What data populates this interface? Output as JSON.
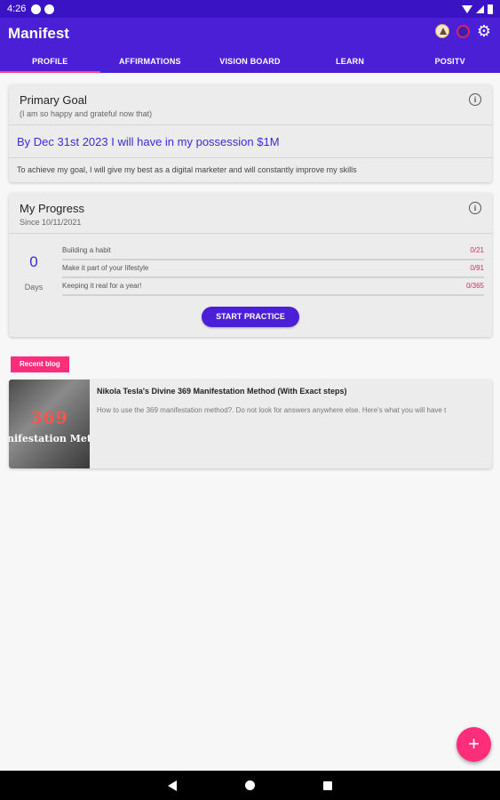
{
  "status_bar": {
    "time": "4:26"
  },
  "app": {
    "title": "Manifest"
  },
  "tabs": [
    {
      "label": "PROFILE",
      "active": true
    },
    {
      "label": "AFFIRMATIONS",
      "active": false
    },
    {
      "label": "VISION BOARD",
      "active": false
    },
    {
      "label": "LEARN",
      "active": false
    },
    {
      "label": "POSITV",
      "active": false
    }
  ],
  "primary_goal": {
    "heading": "Primary Goal",
    "subheading": "(I am so happy and grateful now that)",
    "statement": "By Dec 31st 2023 I will have in my possession $1M",
    "plan": "To achieve my goal, I will give my best as a digital marketer and will constantly improve my skills"
  },
  "progress": {
    "heading": "My Progress",
    "since": "Since 10/11/2021",
    "days_value": "0",
    "days_label": "Days",
    "goals": [
      {
        "label": "Building a habit",
        "count": "0/21"
      },
      {
        "label": "Make it part of your lifestyle",
        "count": "0/91"
      },
      {
        "label": "Keeping it real for a year!",
        "count": "0/365"
      }
    ],
    "start_label": "START PRACTICE"
  },
  "blog": {
    "badge": "Recent blog",
    "title": "Nikola Tesla's Divine 369 Manifestation Method (With Exact steps)",
    "snippet": "How to use the 369 manifestation method?. Do not look for answers anywhere else. Here's what you will have t",
    "thumb_number": "369",
    "thumb_text": "nifestation Meth"
  },
  "fab": {
    "icon": "plus-icon",
    "symbol": "+"
  },
  "colors": {
    "primary": "#4a1fd6",
    "status": "#3a14c4",
    "accent": "#ff2d7a",
    "goal_text": "#3b2bd6"
  }
}
